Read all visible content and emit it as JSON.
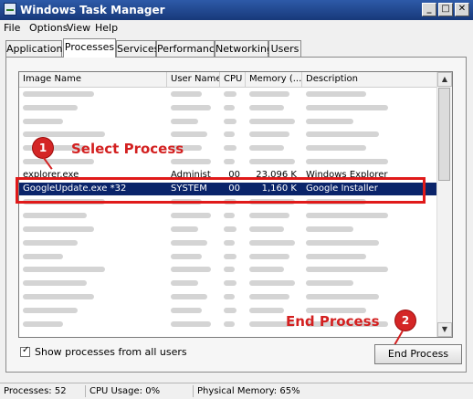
{
  "window": {
    "title": "Windows Task Manager"
  },
  "menu": [
    "File",
    "Options",
    "View",
    "Help"
  ],
  "tabs": [
    {
      "label": "Applications",
      "active": false
    },
    {
      "label": "Processes",
      "active": true
    },
    {
      "label": "Services",
      "active": false
    },
    {
      "label": "Performance",
      "active": false
    },
    {
      "label": "Networking",
      "active": false
    },
    {
      "label": "Users",
      "active": false
    }
  ],
  "columns": [
    "Image Name",
    "User Name",
    "CPU",
    "Memory (...",
    "Description"
  ],
  "rows": [
    {
      "image": "",
      "user": "",
      "cpu": "",
      "memory": "",
      "desc": "",
      "blur": true
    },
    {
      "image": "",
      "user": "",
      "cpu": "",
      "memory": "",
      "desc": "",
      "blur": true
    },
    {
      "image": "",
      "user": "",
      "cpu": "",
      "memory": "",
      "desc": "",
      "blur": true
    },
    {
      "image": "",
      "user": "",
      "cpu": "",
      "memory": "",
      "desc": "",
      "blur": true
    },
    {
      "image": "",
      "user": "",
      "cpu": "",
      "memory": "",
      "desc": "",
      "blur": true
    },
    {
      "image": "",
      "user": "",
      "cpu": "",
      "memory": "",
      "desc": "",
      "blur": true
    },
    {
      "image": "explorer.exe",
      "user": "Administ",
      "cpu": "00",
      "memory": "23,096 K",
      "desc": "Windows Explorer",
      "blur": false
    },
    {
      "image": "GoogleUpdate.exe *32",
      "user": "SYSTEM",
      "cpu": "00",
      "memory": "1,160 K",
      "desc": "Google Installer",
      "blur": false,
      "selected": true
    },
    {
      "image": "",
      "user": "",
      "cpu": "",
      "memory": "",
      "desc": "",
      "blur": true
    },
    {
      "image": "",
      "user": "",
      "cpu": "",
      "memory": "",
      "desc": "",
      "blur": true
    },
    {
      "image": "",
      "user": "",
      "cpu": "",
      "memory": "",
      "desc": "",
      "blur": true
    },
    {
      "image": "",
      "user": "",
      "cpu": "",
      "memory": "",
      "desc": "",
      "blur": true
    },
    {
      "image": "",
      "user": "",
      "cpu": "",
      "memory": "",
      "desc": "",
      "blur": true
    },
    {
      "image": "",
      "user": "",
      "cpu": "",
      "memory": "",
      "desc": "",
      "blur": true
    },
    {
      "image": "",
      "user": "",
      "cpu": "",
      "memory": "",
      "desc": "",
      "blur": true
    },
    {
      "image": "",
      "user": "",
      "cpu": "",
      "memory": "",
      "desc": "",
      "blur": true
    },
    {
      "image": "",
      "user": "",
      "cpu": "",
      "memory": "",
      "desc": "",
      "blur": true
    },
    {
      "image": "",
      "user": "",
      "cpu": "",
      "memory": "",
      "desc": "",
      "blur": true
    }
  ],
  "show_all_users": "Show processes from all users",
  "end_process_button": "End Process",
  "status": {
    "processes": "Processes: 52",
    "cpu": "CPU Usage: 0%",
    "memory": "Physical Memory: 65%"
  },
  "annotations": {
    "step1_number": "1",
    "step1_label": "Select Process",
    "step2_number": "2",
    "step2_label": "End Process"
  },
  "colors": {
    "annotation": "#d32020",
    "selection": "#0a246a"
  }
}
